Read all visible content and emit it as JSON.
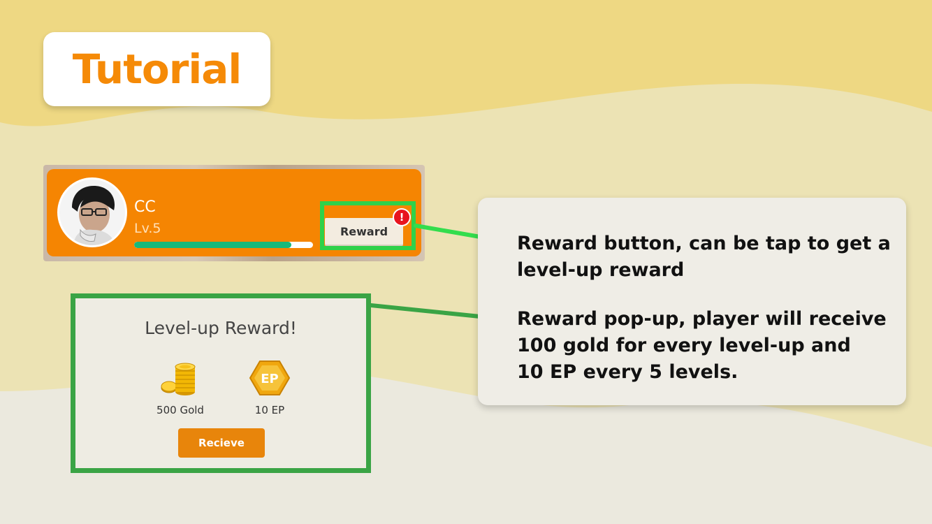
{
  "title": "Tutorial",
  "profile": {
    "name": "CC",
    "level": "Lv.5",
    "xp_progress_percent": 88,
    "reward_button": "Reward",
    "alert_badge": "!"
  },
  "popup": {
    "title": "Level-up Reward!",
    "items": [
      {
        "icon": "gold-coins-icon",
        "label": "500 Gold"
      },
      {
        "icon": "ep-badge-icon",
        "badge_text": "EP",
        "label": "10 EP"
      }
    ],
    "receive_button": "Recieve"
  },
  "info": {
    "reward_button_note": "Reward button, can be tap to get a\nlevel-up reward",
    "popup_note": "Reward pop-up, player will receive\n100 gold for every level-up and\n10 EP every 5 levels."
  },
  "colors": {
    "brand_orange": "#f58502",
    "highlight_green": "#2fd14a",
    "popup_border_green": "#3aa445",
    "xp_bar": "#17b97a",
    "alert_red": "#e8141e"
  }
}
